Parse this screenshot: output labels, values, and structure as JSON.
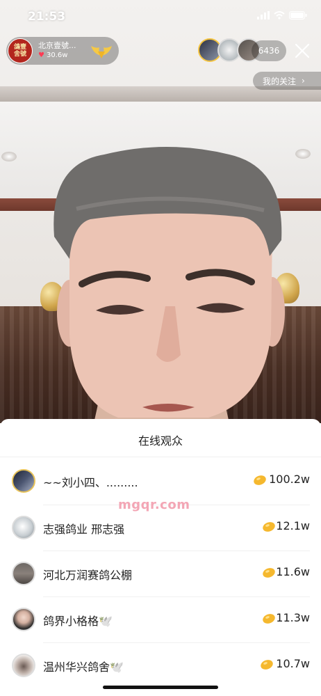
{
  "status_bar": {
    "time": "21:53"
  },
  "host": {
    "name": "北京壹號...",
    "likes": "30.6w",
    "avatar_text": "鴿壹舍號"
  },
  "top_right": {
    "viewer_count": "6436",
    "follow_label": "我的关注"
  },
  "panel": {
    "title": "在线观众",
    "viewers": [
      {
        "name": "~~刘小四、.........",
        "score": "100.2w"
      },
      {
        "name": "志强鸽业  邢志强",
        "score": "12.1w"
      },
      {
        "name": "河北万润赛鸽公棚",
        "score": "11.6w"
      },
      {
        "name": "鸽界小格格🕊️",
        "score": "11.3w"
      },
      {
        "name": "温州华兴鸽舍🕊️",
        "score": "10.7w"
      }
    ]
  },
  "watermark": "mgqr.com",
  "colors": {
    "accent_gold": "#f4c441",
    "coin": "#f5b82e",
    "heart": "#ff3b53"
  }
}
